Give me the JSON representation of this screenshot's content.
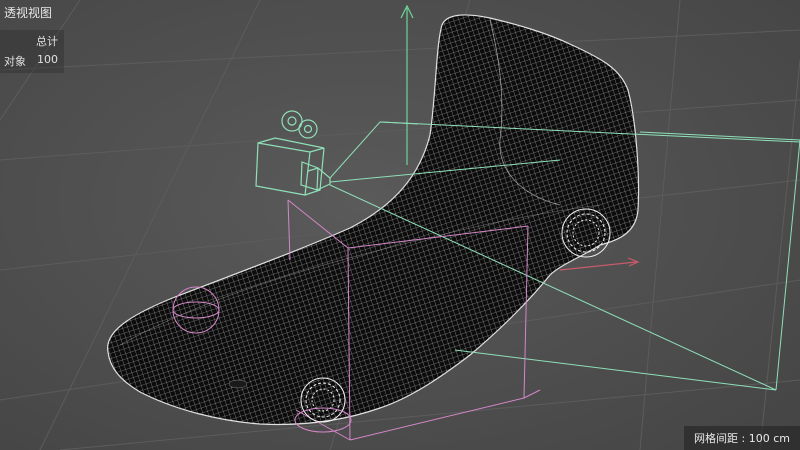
{
  "viewport": {
    "name": "透视视图",
    "stats": {
      "header": "总计",
      "row_label": "对象",
      "row_value": "100"
    },
    "grid_spacing": "网格间距 : 100 cm"
  },
  "colors": {
    "background": "#4d4d4d",
    "grid_line": "#5c5c5c",
    "mesh_fill": "#0c0c0c",
    "mesh_wire": "#dcdcdc",
    "camera_wire": "#8fe0b8",
    "light_wire": "#d487c8",
    "axis_green": "#6fd39a",
    "axis_red": "#c75b6a"
  },
  "icons": [
    "camera-icon",
    "light-icon"
  ]
}
